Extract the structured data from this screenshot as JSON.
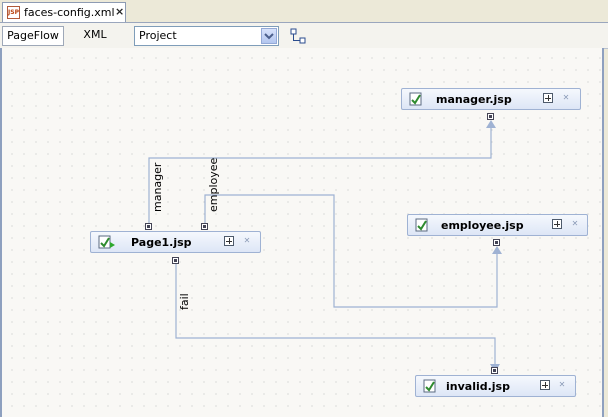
{
  "editor_tab": {
    "title": "faces-config.xml",
    "badge": "JSP",
    "close": "×"
  },
  "toolbar": {
    "pageflow_label": "PageFlow",
    "xml_label": "XML",
    "scope_select": {
      "value": "Project"
    }
  },
  "canvas": {
    "nodes": {
      "manager": {
        "label": "manager.jsp"
      },
      "employee": {
        "label": "employee.jsp"
      },
      "page1": {
        "label": "Page1.jsp"
      },
      "invalid": {
        "label": "invalid.jsp"
      }
    },
    "cases": {
      "manager": "manager",
      "employee": "employee",
      "fail": "fail"
    }
  },
  "colors": {
    "wire": "#9fb2d3",
    "canvas_bg": "#f9f8f5",
    "node_border": "#9fb2d3"
  }
}
